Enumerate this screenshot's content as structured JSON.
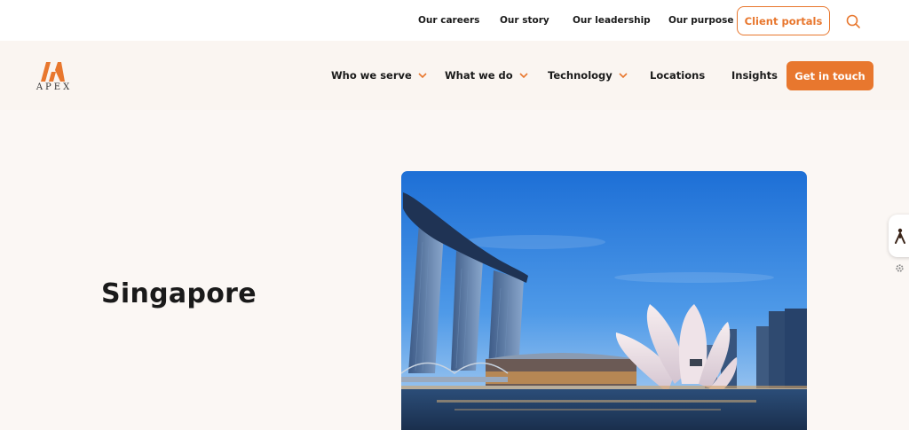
{
  "top_links": [
    "Our careers",
    "Our story",
    "Our leadership",
    "Our purpose"
  ],
  "client_portals_label": "Client portals",
  "logo_text": "APEX",
  "nav": {
    "items": [
      "Who we serve",
      "What we do",
      "Technology",
      "Locations",
      "Insights"
    ],
    "cta_label": "Get in touch"
  },
  "hero": {
    "title": "Singapore"
  },
  "colors": {
    "accent": "#e8772e",
    "background": "#fbf7f4",
    "text": "#1a1a1a"
  },
  "icons": {
    "search": "search-icon",
    "chevron": "chevron-down-icon",
    "accessibility": "accessibility-icon",
    "settings": "gear-icon"
  }
}
